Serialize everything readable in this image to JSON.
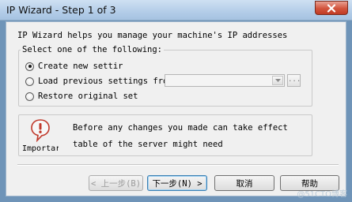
{
  "window": {
    "title": "IP Wizard - Step 1 of 3",
    "close_icon": "close-icon"
  },
  "intro_text": "IP Wizard helps you manage your machine's IP addresses",
  "options_group": {
    "legend": "Select one of the following:",
    "options": [
      {
        "label": "Create new settir",
        "checked": true
      },
      {
        "label": "Load previous settings fro",
        "checked": false
      },
      {
        "label": "Restore original set",
        "checked": false
      }
    ],
    "load_combo_value": "",
    "browse_label": "..."
  },
  "notice": {
    "icon": "warning-icon",
    "label": "Importar",
    "line1": "Before any changes you made can take effect",
    "line2": "table of the server might need"
  },
  "buttons": {
    "back": "< 上一步(B)",
    "next": "下一步(N) >",
    "cancel": "取消",
    "help": "帮助"
  },
  "watermark": "@51CTO博客",
  "colors": {
    "close_button": "#d2543d",
    "title_bar": "#b3cde8",
    "dialog_bg": "#f0f0f0"
  }
}
